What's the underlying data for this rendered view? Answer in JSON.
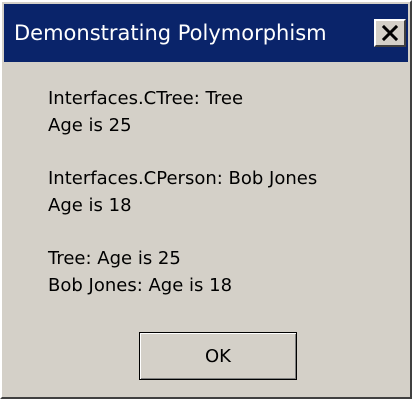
{
  "dialog": {
    "title": "Demonstrating Polymorphism",
    "close_glyph": "X",
    "message_lines": [
      "Interfaces.CTree: Tree",
      "Age is 25",
      "Interfaces.CPerson: Bob Jones",
      "Age is 18",
      "Tree: Age is 25",
      "Bob Jones: Age is 18"
    ],
    "ok_label": "OK"
  },
  "colors": {
    "title_bar": "#0a246a",
    "dialog_face": "#d4d0c8",
    "background": "#bfbfbf"
  }
}
